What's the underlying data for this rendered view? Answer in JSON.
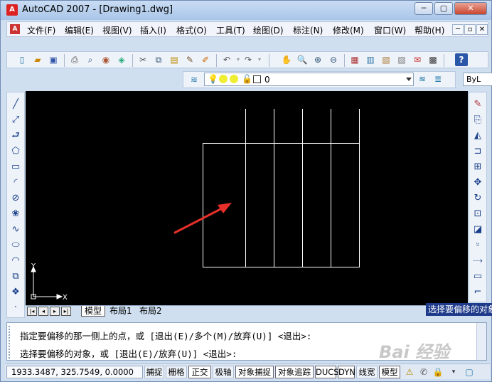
{
  "window": {
    "title": "AutoCAD 2007 - [Drawing1.dwg]",
    "icon": "A",
    "minimize": "─",
    "restore": "▢",
    "close": "✕"
  },
  "menu": {
    "icon": "A",
    "items": [
      "文件(F)",
      "编辑(E)",
      "视图(V)",
      "插入(I)",
      "格式(O)",
      "工具(T)",
      "绘图(D)",
      "标注(N)",
      "修改(M)",
      "窗口(W)",
      "帮助(H)"
    ],
    "mdi_minimize": "─",
    "mdi_restore": "▫",
    "mdi_close": "✕"
  },
  "layer": {
    "current_value": "0",
    "bylayer": "ByL"
  },
  "layout_tabs": [
    "模型",
    "布局1",
    "布局2"
  ],
  "tooltip": "选择要偏移的对象",
  "command": {
    "line1": "指定要偏移的那一侧上的点，或 [退出(E)/多个(M)/放弃(U)] <退出>:",
    "line2": "选择要偏移的对象，或 [退出(E)/放弃(U)] <退出>:"
  },
  "status": {
    "coordinates": "1933.3487, 325.7549, 0.0000",
    "buttons": [
      "捕捉",
      "栅格",
      "正交",
      "极轴",
      "对象捕捉",
      "对象追踪",
      "DUCS",
      "DYN",
      "线宽",
      "模型"
    ],
    "active": [
      "正交",
      "对象捕捉",
      "对象追踪",
      "DUCS",
      "DYN",
      "模型"
    ]
  },
  "ucs": {
    "x": "X",
    "y": "Y"
  },
  "watermark": "Bai 经验",
  "colors": {
    "canvas": "#000000",
    "arrow": "#e8302a",
    "lines": "#ffffff",
    "tooltip": "#1e3a8a"
  }
}
